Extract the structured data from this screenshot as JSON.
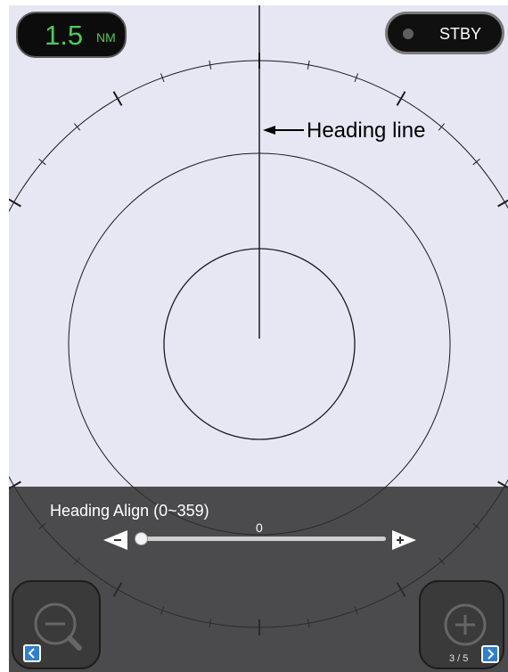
{
  "range": {
    "value": "1.5",
    "unit": "NM"
  },
  "mode": {
    "label": "STBY"
  },
  "annotation": {
    "heading_line": "Heading line"
  },
  "heading_align": {
    "label": "Heading Align (0~359)",
    "value": "0",
    "min": 0,
    "max": 359,
    "current": 0
  },
  "pager": {
    "indicator": "3 / 5"
  },
  "colors": {
    "range_text": "#4fc95a",
    "radar_bg": "#e6e7f3",
    "nav_blue": "#2f7fcf"
  },
  "icons": {
    "zoom_out": "zoom-out-icon",
    "zoom_in": "zoom-in-icon",
    "prev": "chevron-left-icon",
    "next": "chevron-right-icon"
  }
}
